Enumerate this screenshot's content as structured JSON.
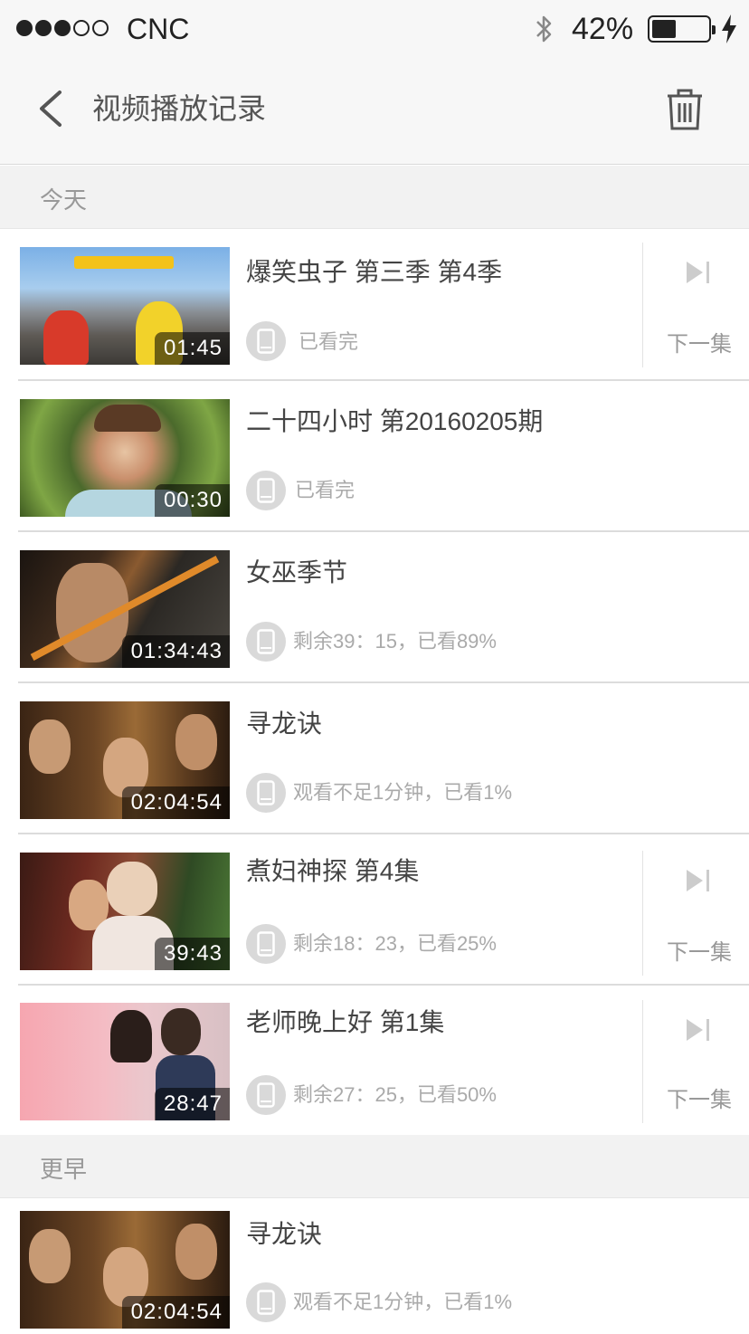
{
  "status_bar": {
    "carrier": "CNC",
    "battery_percent": "42%",
    "battery_level": 0.42,
    "signal_bars_on": 3,
    "signal_bars_total": 5
  },
  "navbar": {
    "title": "视频播放记录",
    "back_icon": "chevron-left-icon",
    "trash_icon": "trash-icon"
  },
  "sections": {
    "today": "今天",
    "earlier": "更早"
  },
  "next_label": "下一集",
  "items": [
    {
      "title": "爆笑虫子 第三季 第4季",
      "duration": "01:45",
      "progress": "已看完",
      "has_next": true
    },
    {
      "title": "二十四小时 第20160205期",
      "duration": "00:30",
      "progress": "已看完",
      "has_next": false
    },
    {
      "title": "女巫季节",
      "duration": "01:34:43",
      "progress": "剩余39：15，已看89%",
      "has_next": false
    },
    {
      "title": "寻龙诀",
      "duration": "02:04:54",
      "progress": "观看不足1分钟，已看1%",
      "has_next": false
    },
    {
      "title": "煮妇神探 第4集",
      "duration": "39:43",
      "progress": "剩余18：23，已看25%",
      "has_next": true
    },
    {
      "title": "老师晚上好 第1集",
      "duration": "28:47",
      "progress": "剩余27：25，已看50%",
      "has_next": true
    },
    {
      "title": "寻龙诀",
      "duration": "02:04:54",
      "progress": "观看不足1分钟，已看1%",
      "has_next": false
    }
  ]
}
